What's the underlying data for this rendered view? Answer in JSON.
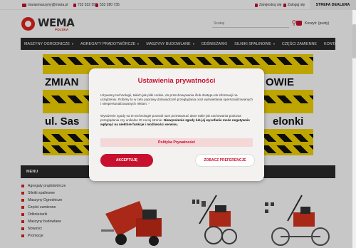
{
  "topbar": {
    "email": "marasmaszyny@maria.pl",
    "phone1": "733 532 552",
    "phone2": "533 280 735",
    "register": "Zarejestruj się",
    "login": "Zaloguj się",
    "dealer": "STREFA DEALERA"
  },
  "header": {
    "logo_text": "WEMA",
    "logo_sub": "POLSKA",
    "search_placeholder": "Szukaj",
    "cart": "Koszyk: (pusty)"
  },
  "nav": {
    "items": [
      {
        "label": "MASZYNY OGRODNICZE",
        "dropdown": true
      },
      {
        "label": "AGREGATY PRĄDOTWÓRCZE",
        "dropdown": true
      },
      {
        "label": "MASZYNY BUDOWLANE",
        "dropdown": true
      },
      {
        "label": "ODŚNIEŻARKI",
        "dropdown": false
      },
      {
        "label": "SILNIKI SPALINOWE",
        "dropdown": true
      },
      {
        "label": "CZĘŚCI ZAMIENNE",
        "dropdown": false
      },
      {
        "label": "KONTAKT",
        "dropdown": false
      }
    ]
  },
  "banner": {
    "line1_left": "ZMIAN",
    "line1_right": "OWIE",
    "line2_left": "ul. Sas",
    "line2_right": "elonki"
  },
  "sidebar": {
    "menu_title": "MENU",
    "categories": [
      "Agregaty prądotwórcze",
      "Silniki spalinowe",
      "Maszyny Ogrodnicze",
      "Części zamienne",
      "Odśnieżarki",
      "Maszyny budowlane",
      "Nowości",
      "Promocje"
    ]
  },
  "cookie_modal": {
    "title": "Ustawienia prywatności",
    "para1": "Używamy technologii, takich jak pliki cookie, do przechowywania i/lub dostępu do informacji na urządzeniu. Robimy to w celu poprawy doświadczeń przeglądania oraz wyświetlania spersonalizowanych i niespersonalizowanych reklam.",
    "para2_normal": "Wyrażenie zgody na te technologie pozwoli nam przetwarzać dane takie jak zachowania podczas przeglądania czy unikalne ID na tej stronie. ",
    "para2_bold": "Niewyrażenie zgody lub jej wycofanie może negatywnie wpłynąć na niektóre funkcje i możliwości serwisu.",
    "policy_button": "Polityka Prywatności",
    "accept_button": "AKCEPTUJĘ",
    "prefs_button": "ZOBACZ PREFERENCJE"
  },
  "colors": {
    "brand_red": "#c8102e",
    "nav_dark": "#2b2b2b",
    "banner_yellow": "#f4d400"
  }
}
